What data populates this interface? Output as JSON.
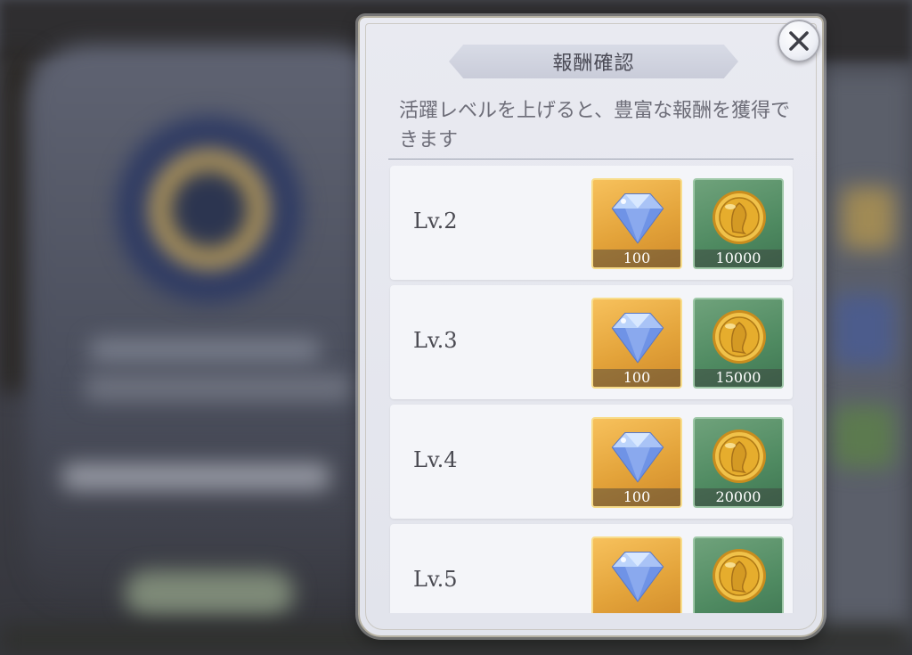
{
  "dialog": {
    "title": "報酬確認",
    "description": "活躍レベルを上げると、豊富な報酬を獲得できます",
    "close_icon": "close-icon"
  },
  "rewards": [
    {
      "level": "Lv.2",
      "gem_qty": "100",
      "coin_qty": "10000"
    },
    {
      "level": "Lv.3",
      "gem_qty": "100",
      "coin_qty": "15000"
    },
    {
      "level": "Lv.4",
      "gem_qty": "100",
      "coin_qty": "20000"
    },
    {
      "level": "Lv.5",
      "gem_qty": "",
      "coin_qty": ""
    }
  ],
  "icons": {
    "gem": "diamond-icon",
    "coin": "gold-coin-icon"
  },
  "colors": {
    "gem_bg": "#e3a33a",
    "coin_bg": "#4f8a61",
    "panel": "#e5e7ee"
  }
}
